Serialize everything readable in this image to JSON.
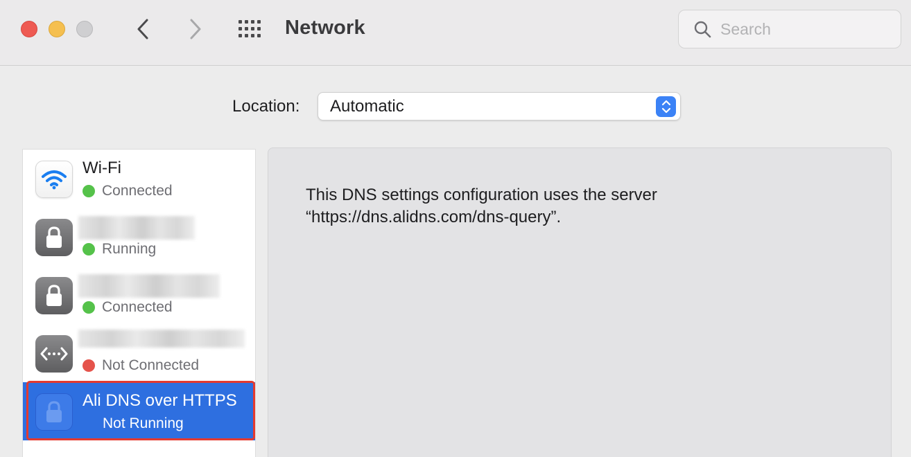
{
  "window": {
    "title": "Network",
    "search_placeholder": "Search"
  },
  "location": {
    "label": "Location:",
    "value": "Automatic"
  },
  "services": [
    {
      "name": "Wi-Fi",
      "status": "Connected",
      "status_color": "#55c24a",
      "icon": "wifi-icon"
    },
    {
      "name": "",
      "status": "Running",
      "status_color": "#55c24a",
      "icon": "lock-icon",
      "name_obscured": true
    },
    {
      "name": "",
      "status": "Connected",
      "status_color": "#55c24a",
      "icon": "lock-icon",
      "name_obscured": true
    },
    {
      "name": "",
      "status": "Not Connected",
      "status_color": "#e5534b",
      "icon": "bridge-icon",
      "name_obscured": true
    },
    {
      "name": "Ali DNS over HTTPS",
      "status": "Not Running",
      "icon": "lock-icon",
      "selected": true
    }
  ],
  "detail": {
    "message": "This DNS settings configuration uses the server “https://dns.alidns.com/dns-query”."
  },
  "colors": {
    "accent": "#2e6fe0",
    "highlight_outline": "#e53a2f"
  }
}
